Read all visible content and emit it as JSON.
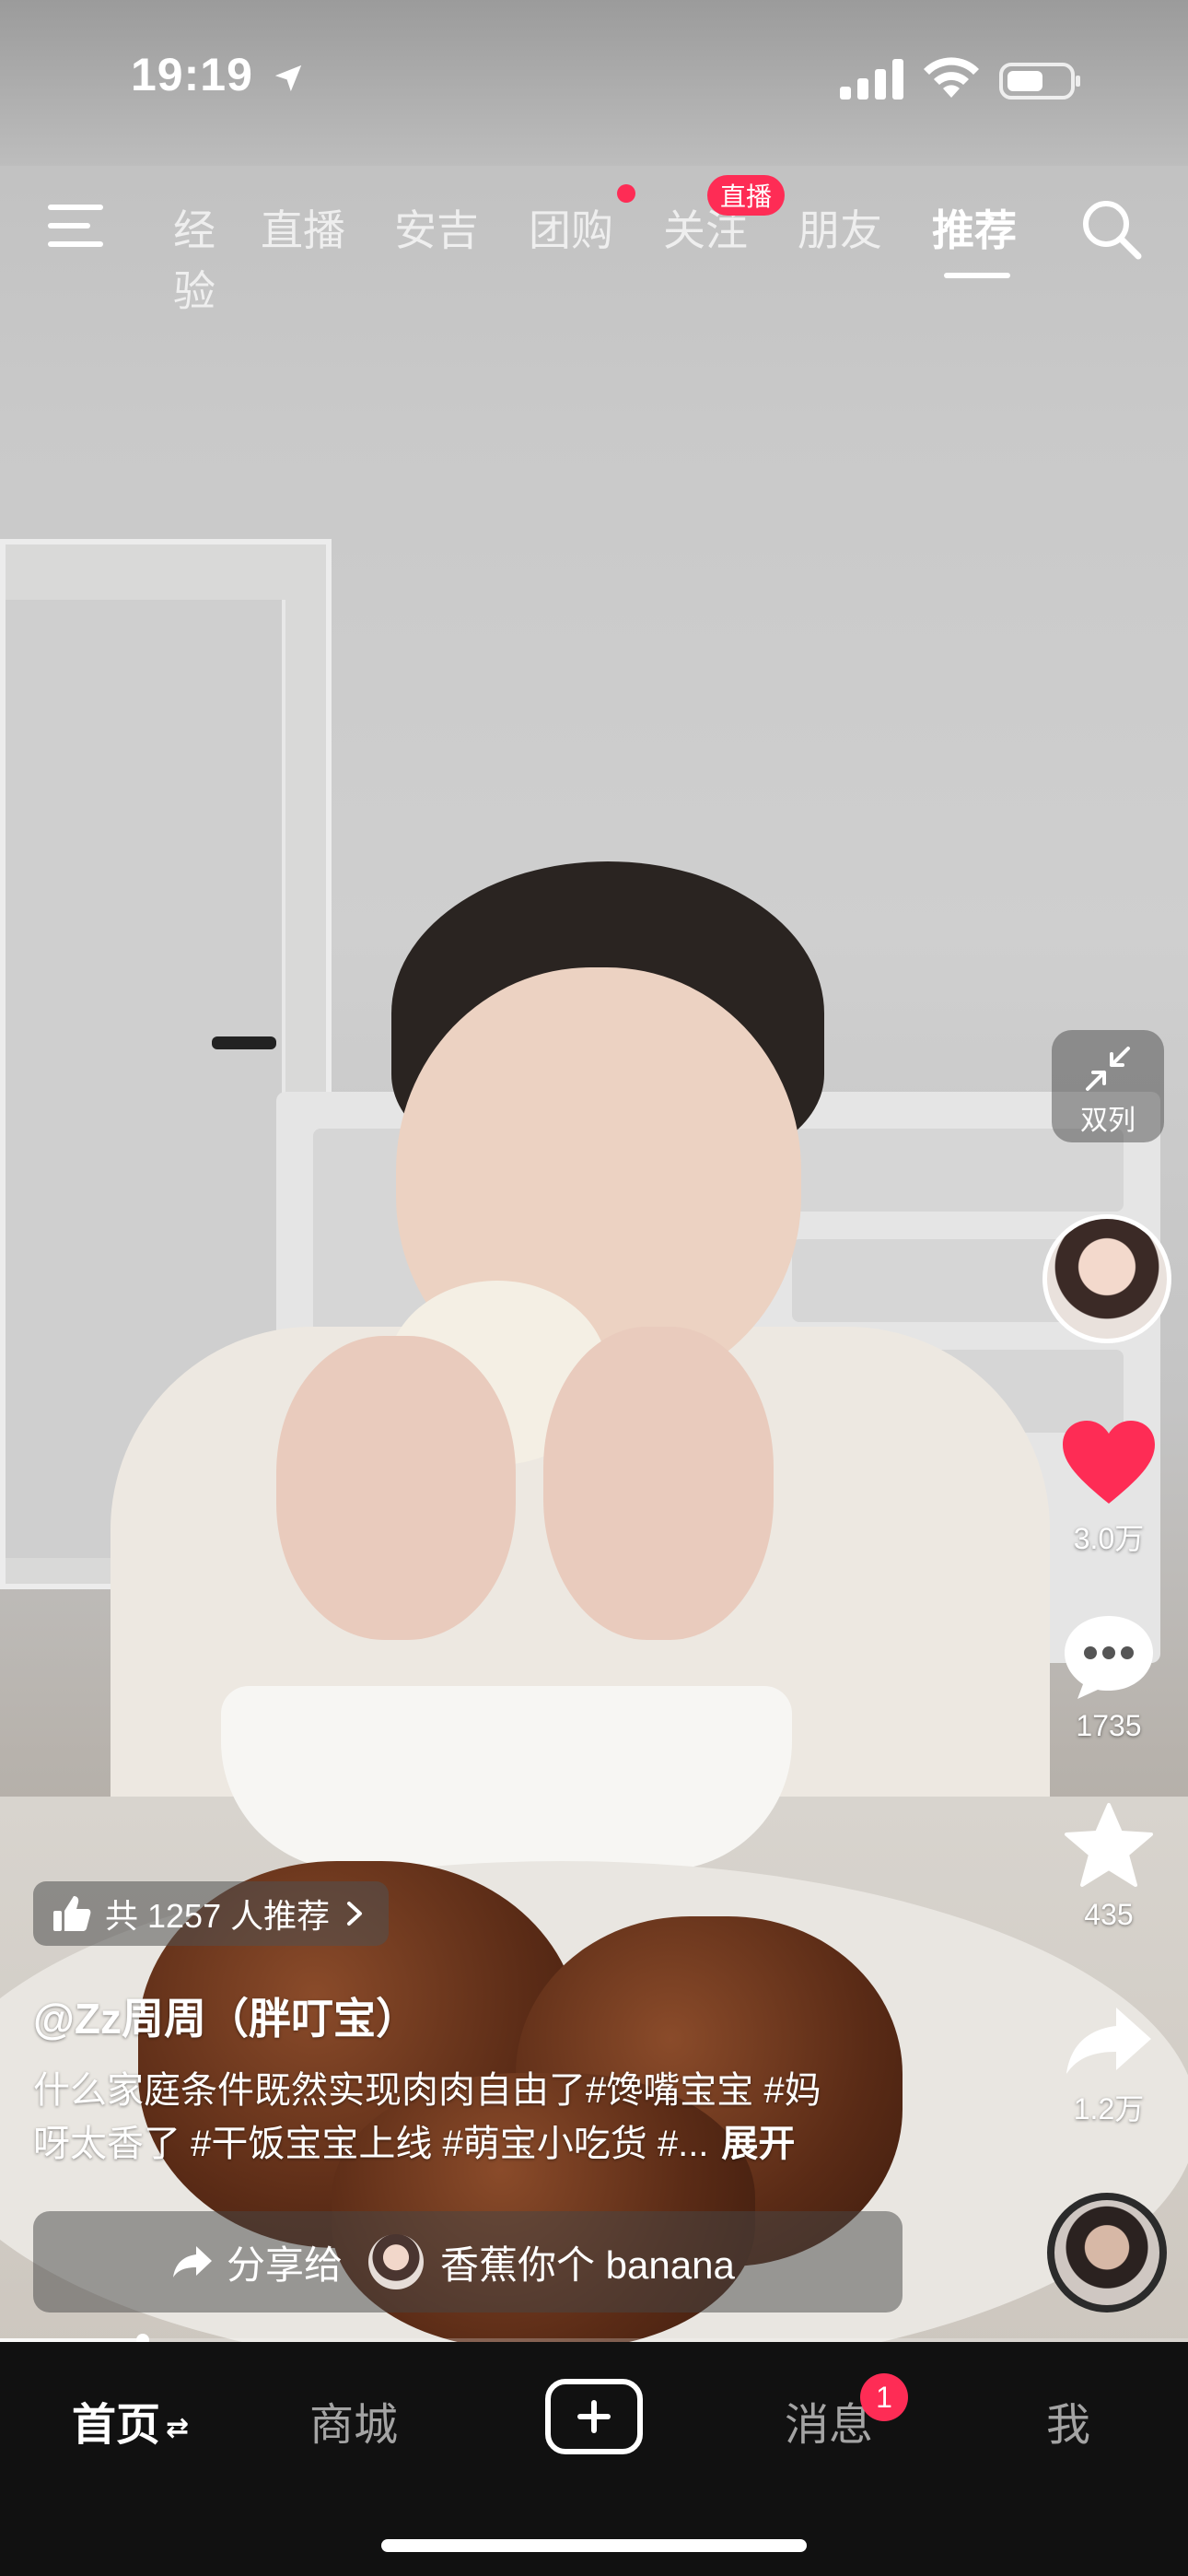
{
  "status_bar": {
    "time": "19:19"
  },
  "top_nav": {
    "tabs": [
      {
        "label": "经验"
      },
      {
        "label": "直播"
      },
      {
        "label": "安吉"
      },
      {
        "label": "团购"
      },
      {
        "label": "关注"
      },
      {
        "label": "朋友"
      },
      {
        "label": "推荐"
      }
    ],
    "live_badge": "直播",
    "active_tab": "推荐"
  },
  "right_rail": {
    "dual_column_label": "双列",
    "like_count": "3.0万",
    "comment_count": "1735",
    "favorite_count": "435",
    "share_count": "1.2万",
    "like_color": "#fe2c55"
  },
  "video_info": {
    "recommend_text": "共 1257 人推荐",
    "author": "@Zz周周（胖叮宝）",
    "caption_line1": "什么家庭条件既然实现肉肉自由了#馋嘴宝宝 #妈",
    "caption_line2": "呀太香了 #干饭宝宝上线 #萌宝小吃货 #...",
    "expand_label": "展开",
    "share_label": "分享给",
    "share_target": "香蕉你个 banana"
  },
  "progress": {
    "fraction": 0.12
  },
  "bottom_tabs": {
    "home": "首页",
    "mall": "商城",
    "messages": "消息",
    "messages_badge": "1",
    "me": "我"
  },
  "icons": {
    "menu": "menu-icon",
    "search": "search-icon",
    "collapse": "collapse-icon",
    "like": "heart-icon",
    "comment": "comment-icon",
    "favorite": "star-icon",
    "share": "share-icon",
    "thumbs_up": "thumbs-up-icon"
  }
}
